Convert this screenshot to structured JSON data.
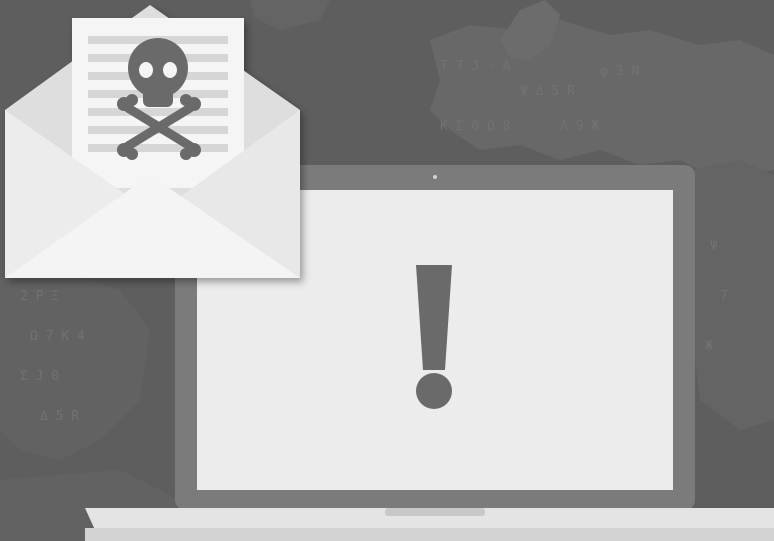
{
  "scene": {
    "background_color": "#5e5e5e",
    "map_color": "#6b6b6b",
    "glyph_color": "#737373",
    "laptop": {
      "bezel_color": "#7a7a7a",
      "screen_color": "#ececec",
      "base_color": "#e6e6e6",
      "icon": "exclamation-icon",
      "icon_color": "#6a6a6a"
    },
    "envelope": {
      "paper_color": "#f2f2f2",
      "line_color": "#d9d9d9",
      "icon": "skull-crossbones-icon",
      "icon_color": "#6a6a6a"
    }
  }
}
